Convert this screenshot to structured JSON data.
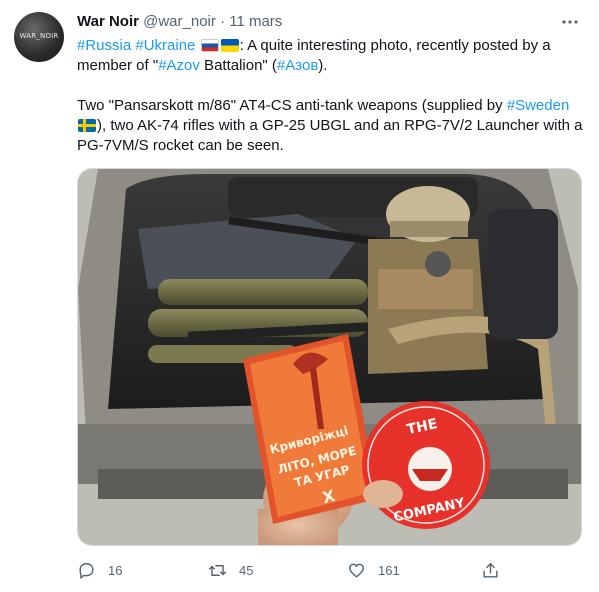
{
  "author": {
    "name": "War Noir",
    "handle": "@war_noir",
    "separator": "·",
    "date": "11 mars",
    "avatar_text": "WAR_NOIR"
  },
  "tweet": {
    "line1_tags": "#Russia #Ukraine",
    "line1_after_flags": ": A quite interesting photo, recently posted by a member of \"",
    "tag_azov": "#Azov",
    "line1_mid": " Battalion\" (",
    "tag_azov_cyr": "#Азов",
    "line1_end": ").",
    "p2_start": "Two \"Pansarskott m/86\" AT4-CS anti-tank weapons (supplied by ",
    "tag_sweden": "#Sweden",
    "p2_rest": "), two AK-74 rifles with a GP-25 UBGL and an RPG-7V/2 Launcher with a PG-7VM/S rocket can be seen."
  },
  "media": {
    "booklet_lines": [
      "Криворіжці",
      "ЛІТО, МОРЕ",
      "ТА УГАР",
      "Х"
    ],
    "sticker_lines": [
      "THE",
      "COMPANY"
    ]
  },
  "stats": {
    "replies": "16",
    "retweets": "45",
    "likes": "161"
  },
  "colors": {
    "link": "#1d9bf0",
    "secondary_text": "#536471",
    "primary_text": "#0f1419"
  },
  "icons": {
    "more": "more-icon",
    "reply": "reply-icon",
    "retweet": "retweet-icon",
    "like": "heart-icon",
    "share": "share-icon"
  }
}
